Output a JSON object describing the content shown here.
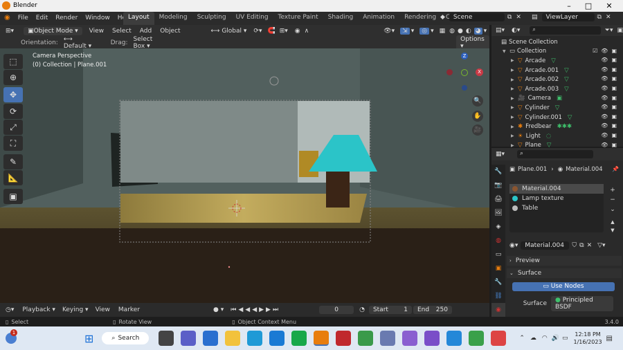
{
  "window": {
    "title": "Blender",
    "minimize": "–",
    "maximize": "□",
    "close": "✕"
  },
  "menubar": {
    "items": [
      "File",
      "Edit",
      "Render",
      "Window",
      "Help"
    ]
  },
  "workspaces": [
    "Layout",
    "Modeling",
    "Sculpting",
    "UV Editing",
    "Texture Paint",
    "Shading",
    "Animation",
    "Rendering",
    "Compositing"
  ],
  "scene": "Scene",
  "view_layer": "ViewLayer",
  "viewport_header": {
    "mode": "Object Mode",
    "menus": [
      "View",
      "Select",
      "Add",
      "Object"
    ],
    "transform": "Global"
  },
  "tool_header": {
    "orientation_label": "Orientation:",
    "orientation": "Default",
    "drag_label": "Drag:",
    "drag": "Select Box",
    "options": "Options"
  },
  "viewport": {
    "camera": "Camera Perspective",
    "collection": "(0) Collection | Plane.001",
    "gizmo": {
      "z": "Z",
      "x": "X"
    }
  },
  "outliner": {
    "scene_collection": "Scene Collection",
    "collection": "Collection",
    "items": [
      "Arcade",
      "Arcade.001",
      "Arcade.002",
      "Arcade.003",
      "Camera",
      "Cylinder",
      "Cylinder.001",
      "Fredbear",
      "Light",
      "Plane"
    ]
  },
  "properties": {
    "object": "Plane.001",
    "material": "Material.004",
    "slots": [
      "Material.004",
      "Lamp texture",
      "Table"
    ],
    "material_field": "Material.004",
    "preview": "Preview",
    "surface": "Surface",
    "use_nodes": "Use Nodes",
    "surface_label": "Surface",
    "surface_value": "Principled BSDF"
  },
  "timeline": {
    "menus": [
      "Playback",
      "Keying",
      "View",
      "Marker"
    ],
    "current_frame": "0",
    "start_label": "Start",
    "start": "1",
    "end_label": "End",
    "end": "250"
  },
  "status": {
    "select": "Select",
    "rotate": "Rotate View",
    "context": "Object Context Menu",
    "version": "3.4.0"
  },
  "taskbar": {
    "search": "Search",
    "time": "12:18 PM",
    "date": "1/16/2023",
    "badge": "1"
  },
  "colors": {
    "accent": "#4672b3",
    "orange": "#e87d0d"
  }
}
